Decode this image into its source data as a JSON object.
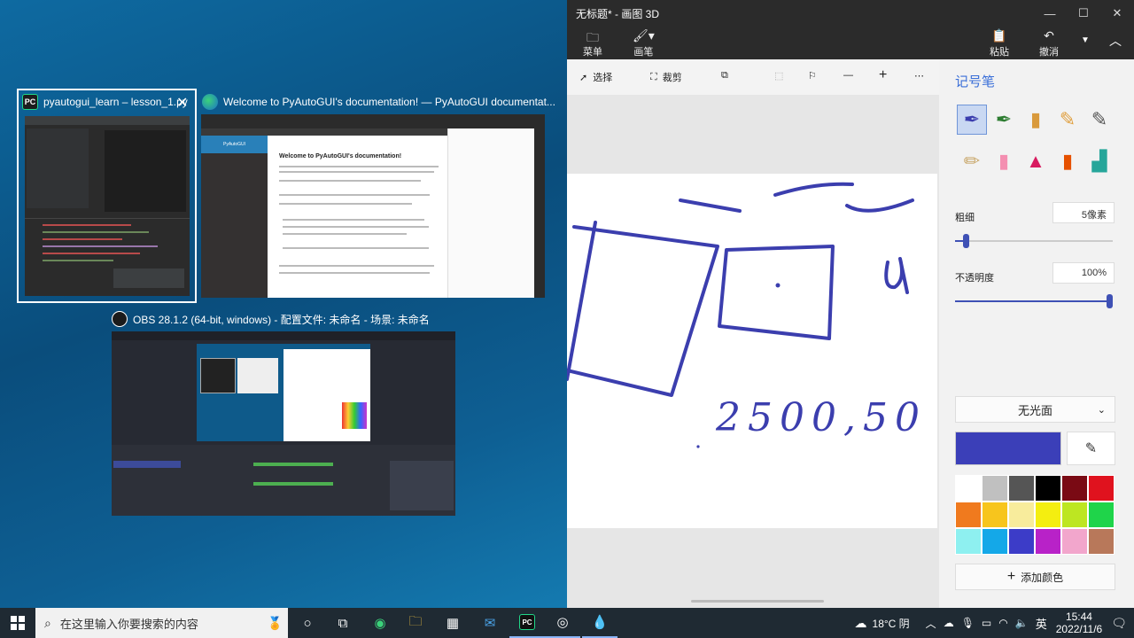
{
  "switcher": {
    "windows": [
      {
        "title": "pyautogui_learn – lesson_1.py",
        "icon": "pycharm-icon"
      },
      {
        "title": "Welcome to PyAutoGUI's documentation! — PyAutoGUI documentat...",
        "icon": "edge-icon"
      },
      {
        "title": "OBS 28.1.2 (64-bit, windows) - 配置文件: 未命名 - 场景: 未命名",
        "icon": "obs-icon"
      }
    ],
    "doc_heading": "Welcome to PyAutoGUI's documentation!",
    "doc_brand": "PyAutoGUI"
  },
  "paint3d": {
    "title": "无标题* - 画图 3D",
    "ribbon": {
      "menu": "菜单",
      "brushes": "画笔",
      "paste": "粘贴",
      "undo": "撤消"
    },
    "toolbar": {
      "select": "选择",
      "crop": "裁剪"
    },
    "canvas_text": "2500,50",
    "panel": {
      "title": "记号笔",
      "thickness_label": "粗细",
      "thickness_value": "5像素",
      "thickness_level": 0.05,
      "opacity_label": "不透明度",
      "opacity_value": "100%",
      "opacity_level": 1.0,
      "finish": "无光面",
      "current_color": "#3b3fb8",
      "add_color": "添加颜色",
      "palette": [
        "#ffffff",
        "#c0c0c0",
        "#555555",
        "#000000",
        "#7a0a14",
        "#e0121e",
        "#f07a1e",
        "#f7c51d",
        "#f8ec9c",
        "#f4ee10",
        "#bde622",
        "#1fd44a",
        "#8ef0f0",
        "#14a8e8",
        "#3c3cc8",
        "#b822c8",
        "#f2a6cc",
        "#b8785a"
      ]
    }
  },
  "taskbar": {
    "search_placeholder": "在这里输入你要搜索的内容",
    "weather": "18°C 阴",
    "ime": "英",
    "time": "15:44",
    "date": "2022/11/6"
  }
}
